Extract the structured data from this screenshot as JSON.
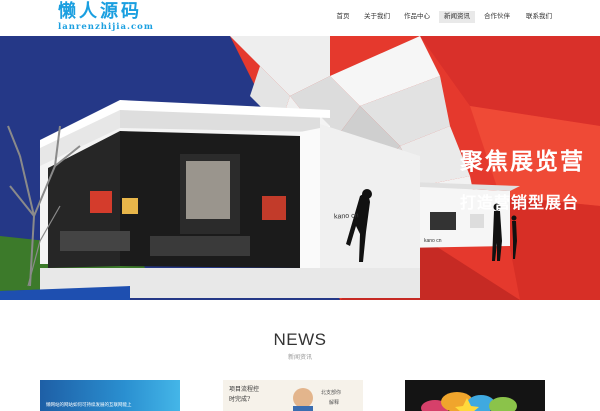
{
  "logo": {
    "cn": "懒人源码",
    "en": "lanrenzhijia.com"
  },
  "nav": {
    "items": [
      "首页",
      "关于我们",
      "作品中心",
      "新闻资讯",
      "合作伙伴",
      "联系我们"
    ],
    "active_index": 3
  },
  "banner": {
    "slogan_main": "聚焦展览营",
    "slogan_sub": "打造营销型展台",
    "booth_brand_a": "kano cn",
    "booth_brand_b": "kano cn"
  },
  "news": {
    "title": "NEWS",
    "subtitle": "新闻资讯",
    "thumbs": [
      {
        "text": "懒网站的网站如何可持续发展的互联网能上"
      },
      {
        "line1": "项目流程控",
        "line2": "时完成?",
        "side1": "北支部你",
        "side2": "解释"
      },
      {}
    ]
  },
  "colors": {
    "brand": "#1a9fe0",
    "banner_red": "#e5392d",
    "wall": "#f2f2f2"
  }
}
